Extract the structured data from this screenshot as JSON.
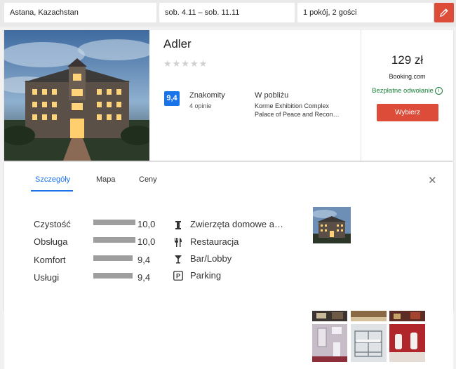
{
  "search": {
    "location": "Astana, Kazachstan",
    "dates": "sob. 4.11  –  sob. 11.11",
    "guests": "1 pokój, 2 gości",
    "edit_icon": "pencil-icon"
  },
  "hotel": {
    "name": "Adler",
    "stars_glyph": "★★★★★",
    "score": "9,4",
    "score_label": "Znakomity",
    "reviews": "4 opinie",
    "nearby_title": "W pobliżu",
    "nearby": [
      "Korme Exhibition Complex",
      "Palace of Peace and Recon…"
    ],
    "price": "129 zł",
    "provider": "Booking.com",
    "cancellation": "Bezpłatne odwołanie",
    "select_label": "Wybierz"
  },
  "details": {
    "tabs": [
      "Szczegóły",
      "Mapa",
      "Ceny"
    ],
    "active_tab": 0,
    "ratings": [
      {
        "label": "Czystość",
        "value": "10,0",
        "score": 10.0
      },
      {
        "label": "Obsługa",
        "value": "10,0",
        "score": 10.0
      },
      {
        "label": "Komfort",
        "value": "9,4",
        "score": 9.4
      },
      {
        "label": "Usługi",
        "value": "9,4",
        "score": 9.4
      }
    ],
    "amenities": [
      {
        "label": "Zwierzęta domowe a…",
        "icon": "pet-icon"
      },
      {
        "label": "Restauracja",
        "icon": "restaurant-icon"
      },
      {
        "label": "Bar/Lobby",
        "icon": "cocktail-icon"
      },
      {
        "label": "Parking",
        "icon": "parking-icon"
      }
    ]
  },
  "colors": {
    "accent_blue": "#1a73e8",
    "action_red": "#dd4b39",
    "free_cancel_green": "#188038"
  }
}
